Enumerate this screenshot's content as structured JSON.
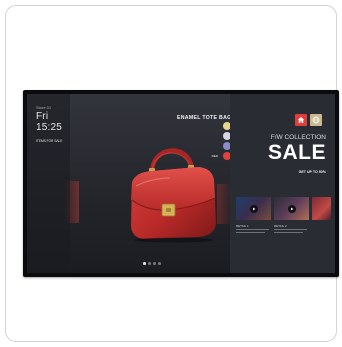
{
  "display": {
    "location": "Store 01",
    "time": "Fri 15:25",
    "menu": [
      {
        "label": "ITEMS FOR SALE",
        "active": true
      },
      {
        "label": "",
        "active": false
      },
      {
        "label": "",
        "active": false
      },
      {
        "label": "",
        "active": false
      }
    ],
    "product": {
      "title": "ENAMEL TOTE BAG",
      "image_icon": "red-handbag-image",
      "color": "#c8302e"
    },
    "swatches": [
      {
        "label": "",
        "color": "#e8d590",
        "active": false
      },
      {
        "label": "",
        "color": "#d7d6e6",
        "active": false
      },
      {
        "label": "",
        "color": "#8b8bc6",
        "active": false
      },
      {
        "label": "RED",
        "color": "#e0433d",
        "active": true
      }
    ],
    "carousel": {
      "count": 4,
      "active_index": 0
    },
    "promo": {
      "home_icon": "home-icon",
      "home_color": "#e03d3b",
      "globe_icon": "globe-icon",
      "globe_color": "#c9b98c",
      "collection": "F/W COLLECTION",
      "sale": "SALE",
      "discount": "GET UP TO 50%"
    },
    "retail": [
      {
        "label": "RETAIL 1",
        "icon": "play-icon"
      },
      {
        "label": "RETAIL 2",
        "icon": "play-icon"
      },
      {
        "label": "",
        "icon": ""
      }
    ]
  }
}
